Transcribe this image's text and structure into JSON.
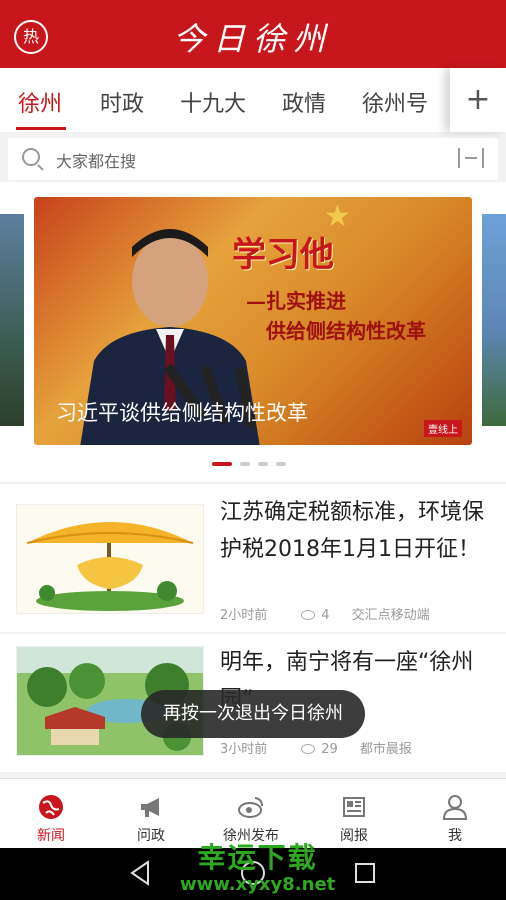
{
  "header": {
    "hot_label": "热",
    "app_title": "今日徐州"
  },
  "tabs": [
    {
      "label": "徐州",
      "active": true
    },
    {
      "label": "时政"
    },
    {
      "label": "十九大"
    },
    {
      "label": "政情"
    },
    {
      "label": "徐州号"
    }
  ],
  "tab_plus": "+",
  "search": {
    "placeholder": "大家都在搜"
  },
  "carousel": {
    "caption": "习近平谈供给侧结构性改革",
    "banner_big": "学习他",
    "banner_line1": "—扎实推进",
    "banner_line2": "供给侧结构性改革",
    "corner_mark": "壹线上",
    "page_count": 4,
    "active_page": 1
  },
  "news": [
    {
      "title": "江苏确定税额标准，环境保护税2018年1月1日开征！",
      "time": "2小时前",
      "views": "4",
      "source": "交汇点移动端"
    },
    {
      "title": "明年，南宁将有一座“徐州园”",
      "time": "3小时前",
      "views": "29",
      "source": "都市晨报"
    }
  ],
  "toast": "再按一次退出今日徐州",
  "bottom_nav": [
    {
      "label": "新闻",
      "icon": "globe-icon",
      "active": true
    },
    {
      "label": "问政",
      "icon": "megaphone-icon"
    },
    {
      "label": "徐州发布",
      "icon": "weibo-icon"
    },
    {
      "label": "阅报",
      "icon": "newspaper-icon"
    },
    {
      "label": "我",
      "icon": "person-icon"
    }
  ],
  "watermark": {
    "line1": "幸运下载",
    "line2": "www.xyxy8.net"
  },
  "colors": {
    "brand": "#c8161d",
    "watermark": "#2fa821"
  }
}
